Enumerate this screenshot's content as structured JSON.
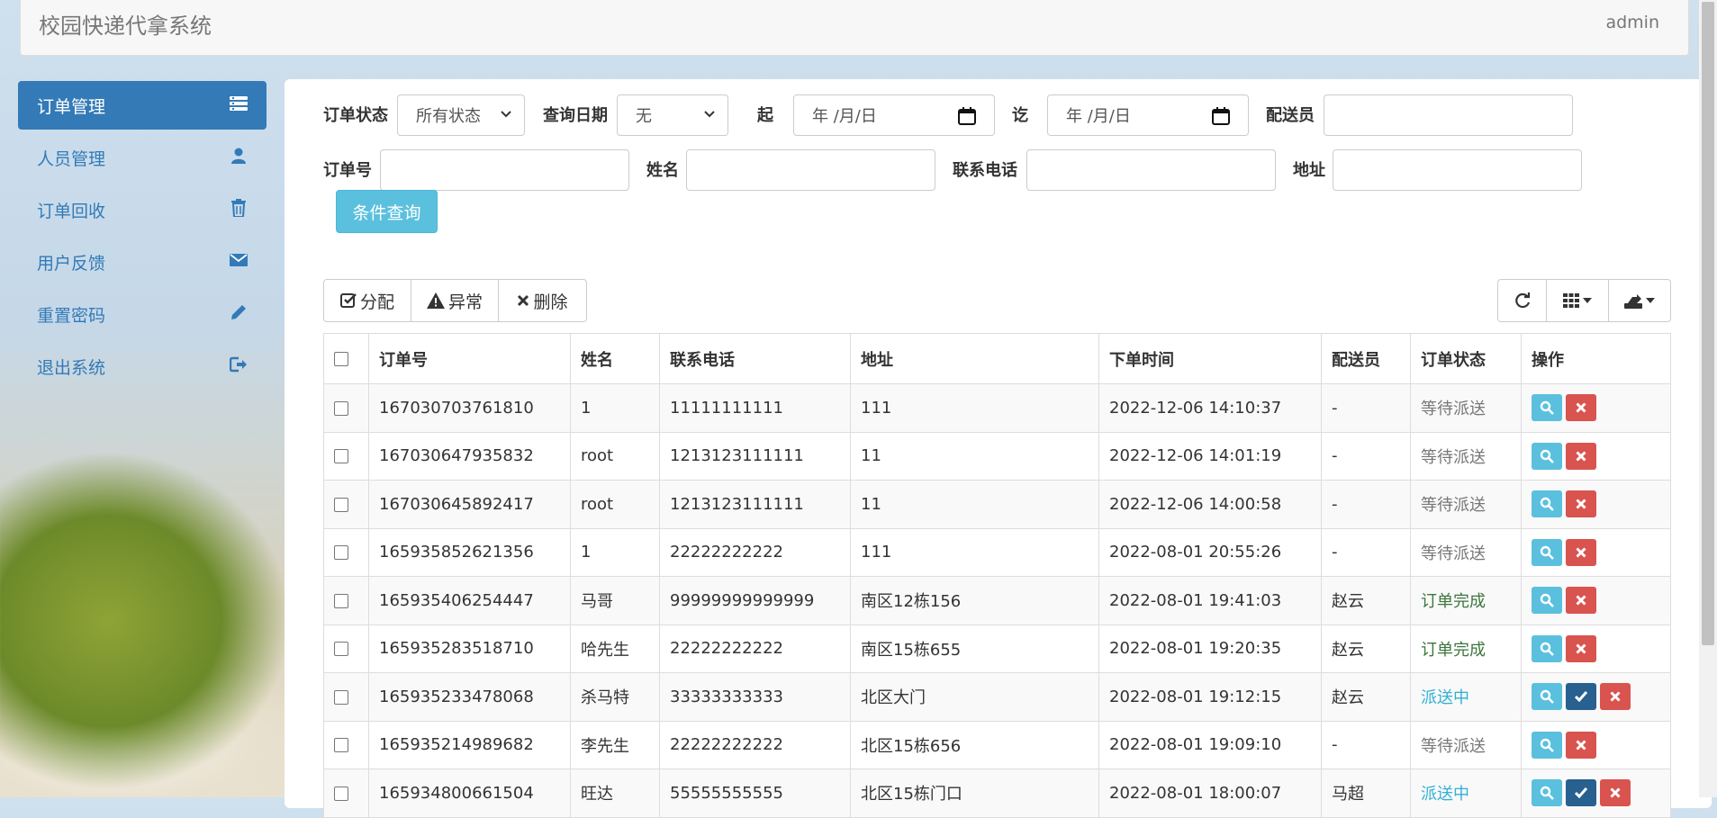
{
  "header": {
    "title": "校园快递代拿系统",
    "user": "admin"
  },
  "sidebar": {
    "items": [
      {
        "label": "订单管理",
        "icon": "list-icon"
      },
      {
        "label": "人员管理",
        "icon": "user-icon"
      },
      {
        "label": "订单回收",
        "icon": "trash-icon"
      },
      {
        "label": "用户反馈",
        "icon": "envelope-icon"
      },
      {
        "label": "重置密码",
        "icon": "pencil-icon"
      },
      {
        "label": "退出系统",
        "icon": "logout-icon"
      }
    ],
    "active_index": 0
  },
  "filters": {
    "status_label": "订单状态",
    "status_value": "所有状态",
    "date_label": "查询日期",
    "date_value": "无",
    "from_label": "起",
    "from_placeholder": "年 /月/日",
    "to_label": "讫",
    "to_placeholder": "年 /月/日",
    "courier_label": "配送员",
    "courier_value": "",
    "order_no_label": "订单号",
    "order_no_value": "",
    "name_label": "姓名",
    "name_value": "",
    "phone_label": "联系电话",
    "phone_value": "",
    "address_label": "地址",
    "address_value": "",
    "query_button": "条件查询"
  },
  "toolbar": {
    "assign": "分配",
    "abnormal": "异常",
    "delete": "删除"
  },
  "table": {
    "columns": [
      "订单号",
      "姓名",
      "联系电话",
      "地址",
      "下单时间",
      "配送员",
      "订单状态",
      "操作"
    ],
    "rows": [
      {
        "order_no": "167030703761810",
        "name": "1",
        "phone": "11111111111",
        "address": "111",
        "time": "2022-12-06 14:10:37",
        "courier": "-",
        "status": "等待派送",
        "status_type": "wait"
      },
      {
        "order_no": "167030647935832",
        "name": "root",
        "phone": "1213123111111",
        "address": "11",
        "time": "2022-12-06 14:01:19",
        "courier": "-",
        "status": "等待派送",
        "status_type": "wait"
      },
      {
        "order_no": "167030645892417",
        "name": "root",
        "phone": "1213123111111",
        "address": "11",
        "time": "2022-12-06 14:00:58",
        "courier": "-",
        "status": "等待派送",
        "status_type": "wait"
      },
      {
        "order_no": "165935852621356",
        "name": "1",
        "phone": "22222222222",
        "address": "111",
        "time": "2022-08-01 20:55:26",
        "courier": "-",
        "status": "等待派送",
        "status_type": "wait"
      },
      {
        "order_no": "165935406254447",
        "name": "马哥",
        "phone": "99999999999999",
        "address": "南区12栋156",
        "time": "2022-08-01 19:41:03",
        "courier": "赵云",
        "status": "订单完成",
        "status_type": "done"
      },
      {
        "order_no": "165935283518710",
        "name": "哈先生",
        "phone": "22222222222",
        "address": "南区15栋655",
        "time": "2022-08-01 19:20:35",
        "courier": "赵云",
        "status": "订单完成",
        "status_type": "done"
      },
      {
        "order_no": "165935233478068",
        "name": "杀马特",
        "phone": "33333333333",
        "address": "北区大门",
        "time": "2022-08-01 19:12:15",
        "courier": "赵云",
        "status": "派送中",
        "status_type": "deliver"
      },
      {
        "order_no": "165935214989682",
        "name": "李先生",
        "phone": "22222222222",
        "address": "北区15栋656",
        "time": "2022-08-01 19:09:10",
        "courier": "-",
        "status": "等待派送",
        "status_type": "wait"
      },
      {
        "order_no": "165934800661504",
        "name": "旺达",
        "phone": "55555555555",
        "address": "北区15栋门口",
        "time": "2022-08-01 18:00:07",
        "courier": "马超",
        "status": "派送中",
        "status_type": "deliver"
      }
    ]
  },
  "colors": {
    "primary": "#337ab7",
    "info": "#5bc0de",
    "danger": "#d9534f",
    "success_text": "#3c763d",
    "muted_text": "#777777"
  }
}
